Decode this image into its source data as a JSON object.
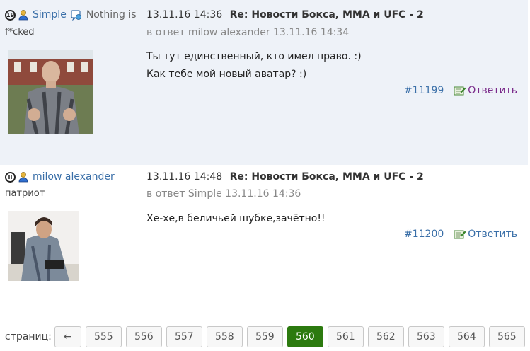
{
  "posts": [
    {
      "username": "Simple",
      "status_text": "Nothing is",
      "user_title": "f*cked",
      "datetime": "13.11.16 14:36",
      "subject": "Re: Новости Бокса, MMA и UFC - 2",
      "in_reply_prefix": "в ответ",
      "in_reply_user": "milow alexander",
      "in_reply_datetime": "13.11.16 14:34",
      "body_lines": [
        "Ты тут единственный, кто имел право. :)",
        "Как тебе мой новый аватар? :)"
      ],
      "post_number": "#11199",
      "reply_label": "Ответить"
    },
    {
      "username": "milow alexander",
      "user_title": "патриот",
      "datetime": "13.11.16 14:48",
      "subject": "Re: Новости Бокса, MMA и UFC - 2",
      "in_reply_prefix": "в ответ",
      "in_reply_user": "Simple",
      "in_reply_datetime": "13.11.16 14:36",
      "body_lines": [
        "Хе-хе,в беличьей шубке,зачётно!!"
      ],
      "post_number": "#11200",
      "reply_label": "Ответить"
    }
  ],
  "pagination": {
    "label": "страниц:",
    "prev_label": "←",
    "pages": [
      "555",
      "556",
      "557",
      "558",
      "559",
      "560",
      "561",
      "562",
      "563",
      "564",
      "565"
    ],
    "current": "560"
  },
  "icons": {
    "rank": "rank-badge-icon",
    "user": "user-online-icon",
    "status": "status-icon",
    "reply": "reply-icon"
  },
  "colors": {
    "link": "#3a6fa8",
    "visited_link": "#7a2a8a",
    "post_highlight_bg": "#eef2f8",
    "active_page": "#2c7a0f"
  }
}
